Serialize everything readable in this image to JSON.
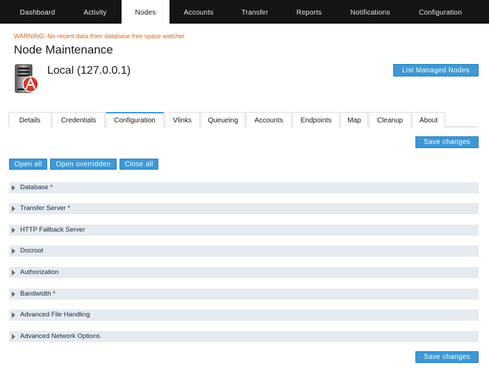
{
  "nav": {
    "items": [
      {
        "label": "Dashboard",
        "active": false
      },
      {
        "label": "Activity",
        "active": false
      },
      {
        "label": "Nodes",
        "active": true
      },
      {
        "label": "Accounts",
        "active": false
      },
      {
        "label": "Transfer",
        "active": false
      },
      {
        "label": "Reports",
        "active": false
      },
      {
        "label": "Notifications",
        "active": false
      },
      {
        "label": "Configuration",
        "active": false
      }
    ]
  },
  "warning": "WARNING: No recent data from database free space watcher",
  "page_title": "Node Maintenance",
  "node": {
    "name": "Local (127.0.0.1)",
    "icon": "server-icon"
  },
  "buttons": {
    "list_managed_nodes": "List Managed Nodes",
    "save_changes": "Save changes",
    "open_all": "Open all",
    "open_overridden": "Open overridden",
    "close_all": "Close all"
  },
  "tabs": [
    {
      "label": "Details",
      "active": false
    },
    {
      "label": "Credentials",
      "active": false
    },
    {
      "label": "Configuration",
      "active": true
    },
    {
      "label": "Vlinks",
      "active": false
    },
    {
      "label": "Queueing",
      "active": false
    },
    {
      "label": "Accounts",
      "active": false
    },
    {
      "label": "Endpoints",
      "active": false
    },
    {
      "label": "Map",
      "active": false
    },
    {
      "label": "Cleanup",
      "active": false
    },
    {
      "label": "About",
      "active": false
    }
  ],
  "sections": [
    {
      "label": "Database *"
    },
    {
      "label": "Transfer Server *"
    },
    {
      "label": "HTTP Fallback Server"
    },
    {
      "label": "Docroot"
    },
    {
      "label": "Authorization"
    },
    {
      "label": "Bandwidth *"
    },
    {
      "label": "Advanced File Handling"
    },
    {
      "label": "Advanced Network Options"
    }
  ],
  "colors": {
    "accent": "#3d98d6",
    "nav_bg": "#141414",
    "warning": "#d2681f",
    "section_bg": "#e4ebf1"
  }
}
